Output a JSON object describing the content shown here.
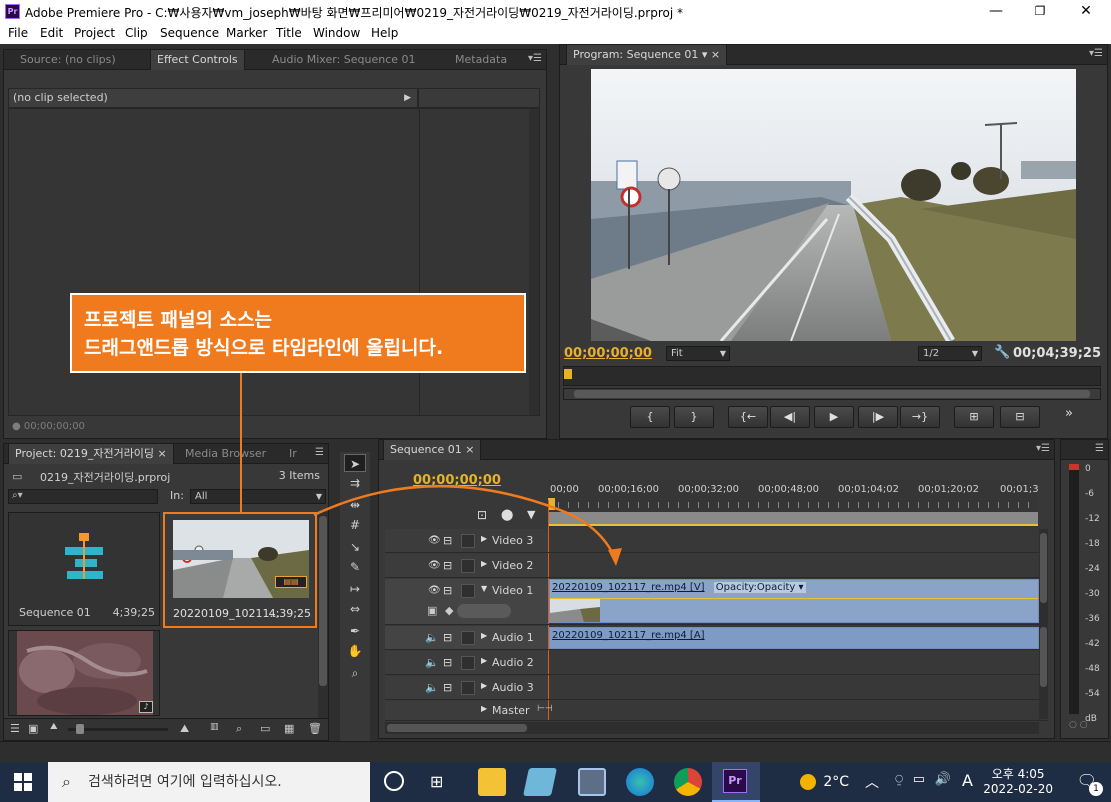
{
  "window": {
    "title": "Adobe Premiere Pro - C:₩사용자₩vm_joseph₩바탕 화면₩프리미어₩0219_자전거라이딩₩0219_자전거라이딩.prproj *",
    "app_icon": "Pr",
    "minimize": "—",
    "maximize": "❐",
    "close": "✕"
  },
  "menu": [
    "File",
    "Edit",
    "Project",
    "Clip",
    "Sequence",
    "Marker",
    "Title",
    "Window",
    "Help"
  ],
  "source_panel": {
    "tabs": [
      "Source: (no clips)",
      "Effect Controls",
      "Audio Mixer: Sequence 01",
      "Metadata"
    ],
    "active_tab": "Effect Controls",
    "no_clip": "(no clip selected)",
    "timecode": "00;00;00;00"
  },
  "program_panel": {
    "tab": "Program: Sequence 01",
    "current_time": "00;00;00;00",
    "fit": "Fit",
    "resolution": "1/2",
    "duration": "00;04;39;25",
    "transport": [
      "{",
      "}",
      "{←",
      "◀|",
      "▶",
      "|▶",
      "→}",
      "⊞",
      "⊟"
    ]
  },
  "callout": {
    "line1": "프로젝트 패널의 소스는",
    "line2": "드래그앤드롭 방식으로 타임라인에 올립니다."
  },
  "project_panel": {
    "tabs": [
      "Project: 0219_자전거라이딩",
      "Media Browser",
      "Ir"
    ],
    "project_file": "0219_자전거라이딩.prproj",
    "items_count": "3 Items",
    "in_label": "In:",
    "in_value": "All",
    "search_placeholder": "",
    "items": [
      {
        "name": "Sequence 01",
        "duration": "4;39;25"
      },
      {
        "name": "20220109_10211...",
        "duration": "4;39;25"
      },
      {
        "name": "",
        "duration": ""
      }
    ]
  },
  "timeline": {
    "tab": "Sequence 01",
    "current_time": "00;00;00;00",
    "ruler": [
      "00;00",
      "00;00;16;00",
      "00;00;32;00",
      "00;00;48;00",
      "00;01;04;02",
      "00;01;20;02",
      "00;01;3"
    ],
    "tracks": [
      {
        "name": "Video 3"
      },
      {
        "name": "Video 2"
      },
      {
        "name": "Video 1"
      },
      {
        "name": "Audio 1"
      },
      {
        "name": "Audio 2"
      },
      {
        "name": "Audio 3"
      },
      {
        "name": "Master"
      }
    ],
    "video_clip": "20220109_102117_re.mp4 [V]",
    "opacity_label": "Opacity:Opacity ▾",
    "audio_clip": "20220109_102117_re.mp4 [A]"
  },
  "audio_meter": {
    "labels": [
      "0",
      "-6",
      "-12",
      "-18",
      "-24",
      "-30",
      "-36",
      "-42",
      "-48",
      "-54",
      "dB"
    ]
  },
  "taskbar": {
    "search_placeholder": "검색하려면 여기에 입력하십시오.",
    "weather": "2°C",
    "ime": "A",
    "time": "오후 4:05",
    "date": "2022-02-20",
    "notifications": "1",
    "colors": {
      "taskbar": "#1f2d44",
      "premiere": "#2a0a47"
    }
  }
}
